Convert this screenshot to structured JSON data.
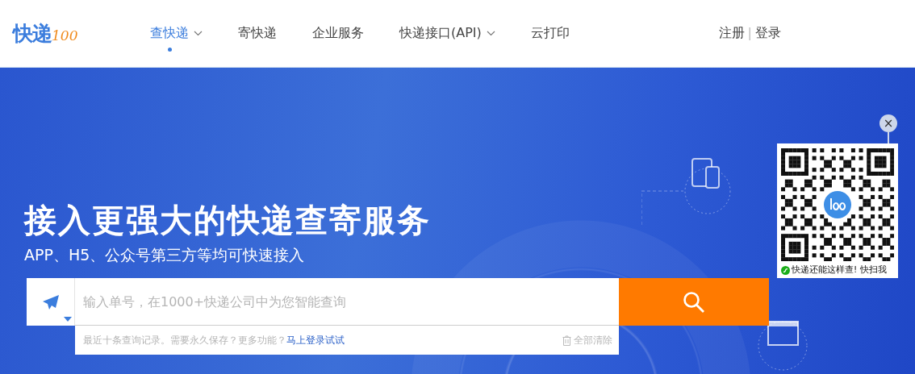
{
  "logo": {
    "main": "快递",
    "sub": "100"
  },
  "nav": [
    {
      "label": "查快递",
      "selected": true,
      "dropdown": true
    },
    {
      "label": "寄快递",
      "selected": false,
      "dropdown": false
    },
    {
      "label": "企业服务",
      "selected": false,
      "dropdown": false
    },
    {
      "label": "快递接口(API)",
      "selected": false,
      "dropdown": true
    },
    {
      "label": "云打印",
      "selected": false,
      "dropdown": false
    }
  ],
  "auth": {
    "register": "注册",
    "separator": "|",
    "login": "登录"
  },
  "hero": {
    "title": "接入更强大的快递查寄服务",
    "subtitle": "APP、H5、公众号第三方等均可快速接入"
  },
  "search": {
    "placeholder": "输入单号，在1000+快递公司中为您智能查询",
    "history_note": "最近十条查询记录。需要永久保存？更多功能？",
    "login_link": "马上登录试试",
    "clear_all": "全部清除"
  },
  "qr_popup": {
    "close": "×",
    "caption": "快递还能这样查! 快扫我"
  }
}
